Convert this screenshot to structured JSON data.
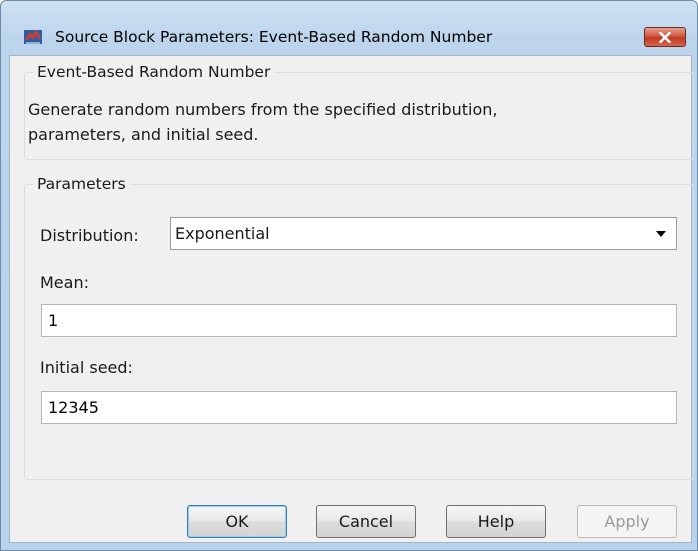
{
  "window": {
    "title": "Source Block Parameters: Event-Based Random Number",
    "close_icon": "close-icon",
    "app_icon": "simulink-block-icon"
  },
  "block_group": {
    "legend": "Event-Based Random Number",
    "description_line1": "Generate random numbers from the specified distribution,",
    "description_line2": "parameters, and initial seed."
  },
  "parameters_group": {
    "legend": "Parameters",
    "distribution_label": "Distribution:",
    "distribution_value": "Exponential",
    "mean_label": "Mean:",
    "mean_value": "1",
    "seed_label": "Initial seed:",
    "seed_value": "12345"
  },
  "buttons": {
    "ok": "OK",
    "cancel": "Cancel",
    "help": "Help",
    "apply": "Apply"
  }
}
